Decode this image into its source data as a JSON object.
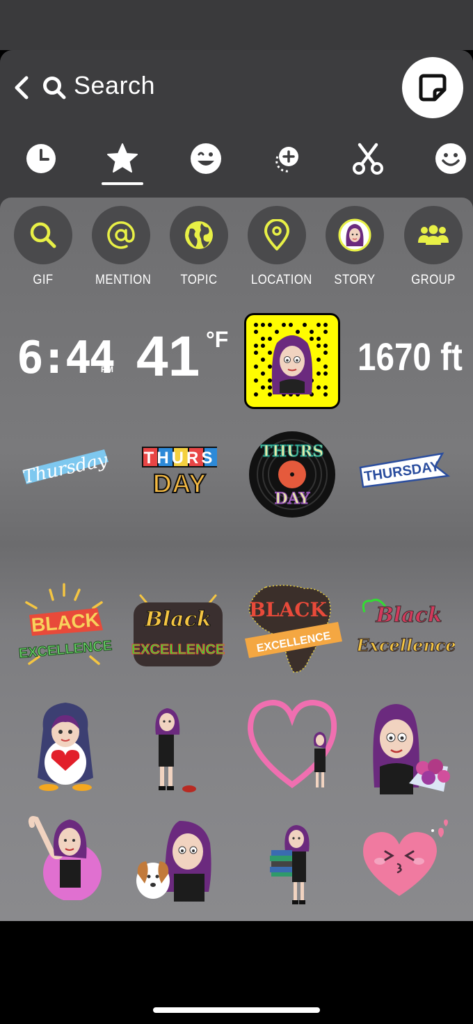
{
  "header": {
    "search_label": "Search",
    "back_icon": "chevron-left-icon",
    "search_icon": "search-icon",
    "sticker_button_icon": "sticker-icon"
  },
  "tabs": [
    {
      "icon": "clock-icon",
      "selected": false
    },
    {
      "icon": "star-icon",
      "selected": true
    },
    {
      "icon": "bitmoji-face-icon",
      "selected": false
    },
    {
      "icon": "add-sticker-icon",
      "selected": false
    },
    {
      "icon": "scissors-icon",
      "selected": false
    },
    {
      "icon": "smiley-icon",
      "selected": false
    }
  ],
  "categories": [
    {
      "label": "GIF",
      "icon": "search-icon"
    },
    {
      "label": "MENTION",
      "icon": "at-icon"
    },
    {
      "label": "TOPIC",
      "icon": "globe-icon"
    },
    {
      "label": "LOCATION",
      "icon": "location-pin-icon"
    },
    {
      "label": "STORY",
      "icon": "bitmoji-avatar-icon"
    },
    {
      "label": "GROUP",
      "icon": "group-icon"
    }
  ],
  "info_stickers": {
    "time": "6:44",
    "ampm": "PM",
    "temperature": "41",
    "temp_unit": "°F",
    "altitude": "1670 ft"
  },
  "day_stickers": [
    {
      "text": "Thursday"
    },
    {
      "line1": "THURS",
      "line2": "DAY"
    },
    {
      "line1": "THURS",
      "line2": "DAY"
    },
    {
      "text": "THURSDAY"
    }
  ],
  "excellence_stickers": [
    {
      "line1": "BLACK",
      "line2": "EXCELLENCE"
    },
    {
      "line1": "Black",
      "line2": "EXCELLENCE"
    },
    {
      "line1": "BLACK",
      "line2": "EXCELLENCE"
    },
    {
      "line1": "Black",
      "line2": "Excellence"
    }
  ],
  "colors": {
    "accent_yellow": "#fffc00",
    "category_icon": "#e8f046",
    "panel_bg": "#3d3d3f"
  }
}
